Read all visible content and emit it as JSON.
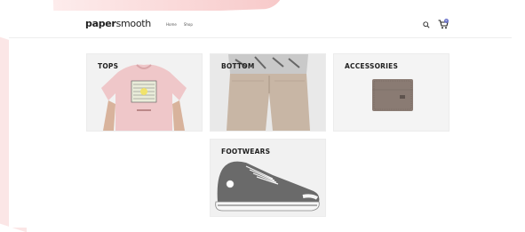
{
  "header": {
    "logo_bold": "paper",
    "logo_light": "smooth",
    "nav": [
      "Home",
      "Shop"
    ],
    "cart_count": "0"
  },
  "categories": [
    {
      "label": "TOPS",
      "image": "pink-tshirt"
    },
    {
      "label": "BOTTOM",
      "image": "beige-pants"
    },
    {
      "label": "ACCESSORIES",
      "image": "leather-wallet"
    },
    {
      "label": "FOOTWEARS",
      "image": "grey-sneaker"
    }
  ],
  "colors": {
    "accent_pink": "#f7c9c9",
    "tile_bg": "#f3f3f3",
    "cart_badge": "#6a72c9"
  }
}
